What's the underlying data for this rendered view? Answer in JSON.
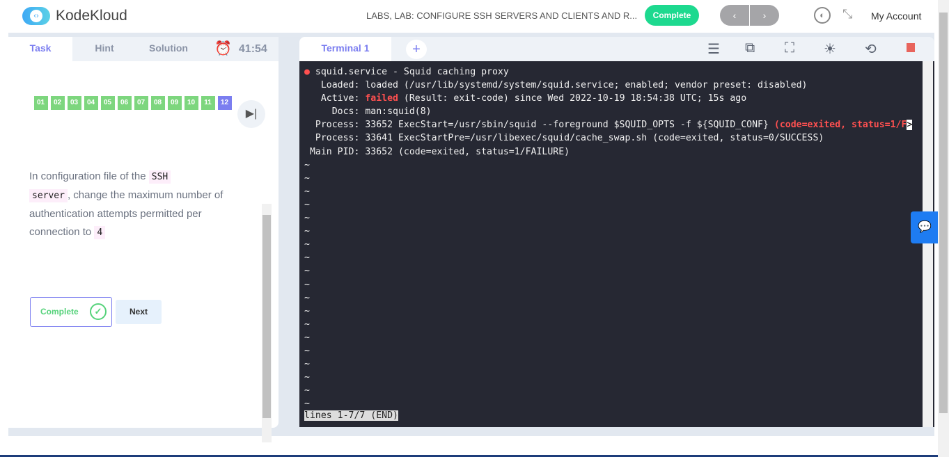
{
  "header": {
    "brand": "KodeKloud",
    "breadcrumb": "LABS, LAB: CONFIGURE SSH SERVERS AND CLIENTS AND R...",
    "complete_label": "Complete",
    "prev": "‹",
    "next": "›",
    "account": "My Account"
  },
  "left": {
    "tabs": [
      "Task",
      "Hint",
      "Solution"
    ],
    "timer": "41:54",
    "steps": [
      "01",
      "02",
      "03",
      "04",
      "05",
      "06",
      "07",
      "08",
      "09",
      "10",
      "11",
      "12"
    ],
    "current_step": "12",
    "task": {
      "t1": "In configuration file of the ",
      "c1": "SSH",
      "c2": "server",
      "t2": ", change the maximum number of authentication attempts permitted per connection to ",
      "c3": "4"
    },
    "complete_label": "Complete",
    "next_label": "Next"
  },
  "terminal": {
    "tab": "Terminal 1",
    "add": "+",
    "lines": [
      {
        "dot": "●",
        "text": " squid.service - Squid caching proxy"
      },
      {
        "text": "   Loaded: loaded (/usr/lib/systemd/system/squid.service; enabled; vendor preset: disabled)"
      },
      {
        "pre": "   Active: ",
        "red": "failed",
        "text": " (Result: exit-code) since Wed 2022-10-19 18:54:38 UTC; 15s ago"
      },
      {
        "text": "     Docs: man:squid(8)"
      },
      {
        "text": "  Process: 33652 ExecStart=/usr/sbin/squid --foreground $SQUID_OPTS -f ${SQUID_CONF} ",
        "red": "(code=exited, status=1/F",
        "post": ">"
      },
      {
        "text": "  Process: 33641 ExecStartPre=/usr/libexec/squid/cache_swap.sh (code=exited, status=0/SUCCESS)"
      },
      {
        "text": " Main PID: 33652 (code=exited, status=1/FAILURE)"
      }
    ],
    "tilde": "~",
    "tilde_count": 19,
    "status": "lines 1-7/7 (END)"
  }
}
